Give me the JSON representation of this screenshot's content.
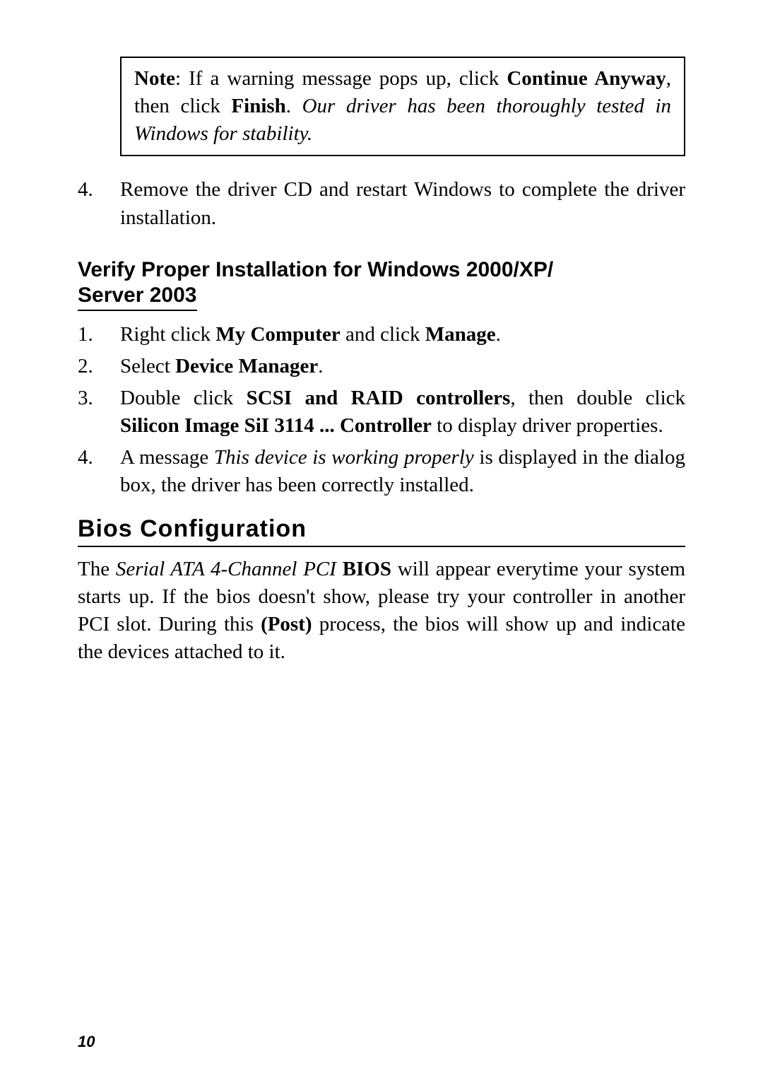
{
  "note_box": {
    "prefix": "Note",
    "text_1": ":  If a warning message pops up, click ",
    "bold_1": "Continue Anyway",
    "text_2": ", then click ",
    "bold_2": "Finish",
    "text_3": ".   ",
    "italic_1": "Our driver has been thoroughly tested in Windows for stability."
  },
  "step_4a": {
    "num": "4.",
    "text": "Remove the driver CD and restart Windows to complete the driver installation."
  },
  "heading_verify": {
    "line1": "Verify Proper Installation for Windows 2000/XP/",
    "line2": "Server 2003"
  },
  "verify_steps": [
    {
      "num": "1.",
      "segments": [
        {
          "t": "Right click ",
          "b": false,
          "i": false
        },
        {
          "t": "My Computer",
          "b": true,
          "i": false
        },
        {
          "t": " and click ",
          "b": false,
          "i": false
        },
        {
          "t": "Manage",
          "b": true,
          "i": false
        },
        {
          "t": ".",
          "b": false,
          "i": false
        }
      ]
    },
    {
      "num": "2.",
      "segments": [
        {
          "t": "Select ",
          "b": false,
          "i": false
        },
        {
          "t": "Device Manager",
          "b": true,
          "i": false
        },
        {
          "t": ".",
          "b": false,
          "i": false
        }
      ]
    },
    {
      "num": "3.",
      "segments": [
        {
          "t": "Double click ",
          "b": false,
          "i": false
        },
        {
          "t": "SCSI and RAID controllers",
          "b": true,
          "i": false
        },
        {
          "t": ", then double click ",
          "b": false,
          "i": false
        },
        {
          "t": "Silicon Image SiI 3114 ... Controller",
          "b": true,
          "i": false
        },
        {
          "t": " to display driver properties.",
          "b": false,
          "i": false
        }
      ]
    },
    {
      "num": "4.",
      "segments": [
        {
          "t": "A message ",
          "b": false,
          "i": false
        },
        {
          "t": "This device is working properly",
          "b": false,
          "i": true
        },
        {
          "t": " is displayed in the dialog box, the driver has been correctly installed.",
          "b": false,
          "i": false
        }
      ]
    }
  ],
  "heading_bios": "Bios  Configuration",
  "bios_para": {
    "segments": [
      {
        "t": "The ",
        "b": false,
        "i": false
      },
      {
        "t": "Serial ATA 4-Channel PCI",
        "b": false,
        "i": true
      },
      {
        "t": " ",
        "b": false,
        "i": false
      },
      {
        "t": "BIOS",
        "b": true,
        "i": false
      },
      {
        "t": " will appear everytime your system starts up.  If the bios doesn't show, please try your controller in another PCI slot.  During this ",
        "b": false,
        "i": false
      },
      {
        "t": "(Post)",
        "b": true,
        "i": false
      },
      {
        "t": " process, the bios will show up and indicate the devices attached to it.",
        "b": false,
        "i": false
      }
    ]
  },
  "page_number": "10"
}
